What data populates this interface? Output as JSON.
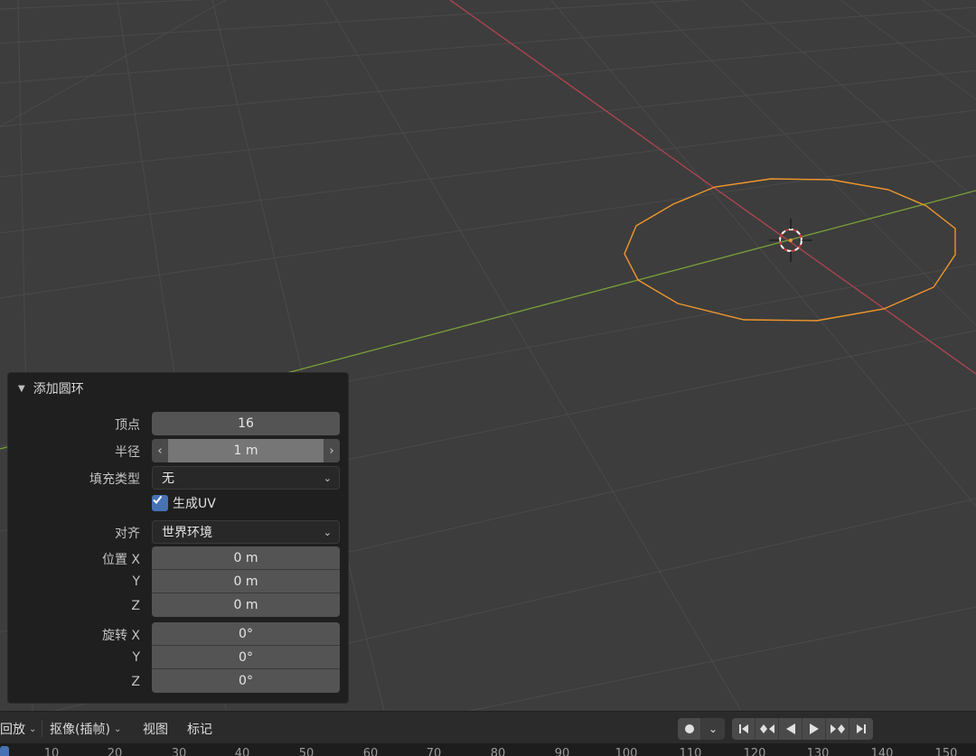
{
  "panel": {
    "title": "添加圆环",
    "labels": {
      "vertices": "顶点",
      "radius": "半径",
      "fill_type": "填充类型",
      "align": "对齐",
      "location": "位置 X",
      "rotation": "旋转 X",
      "y": "Y",
      "z": "Z"
    },
    "vertices": "16",
    "radius": "1 m",
    "fill_type": "无",
    "generate_uv_label": "生成UV",
    "generate_uv_checked": true,
    "align": "世界环境",
    "location": [
      "0 m",
      "0 m",
      "0 m"
    ],
    "rotation": [
      "0°",
      "0°",
      "0°"
    ]
  },
  "timeline": {
    "playback": "回放",
    "keying": "抠像(插帧)",
    "view": "视图",
    "marker": "标记",
    "ruler": [
      "10",
      "20",
      "30",
      "40",
      "50",
      "60",
      "70",
      "80",
      "90",
      "100",
      "110",
      "120",
      "130",
      "140",
      "150"
    ]
  },
  "icons": [
    "chevron-down-icon",
    "checkmark-icon",
    "record-icon",
    "jump-start-icon",
    "prev-keyframe-icon",
    "play-reverse-icon",
    "play-icon",
    "next-keyframe-icon",
    "jump-end-icon",
    "disclosure-triangle-icon",
    "3d-cursor-icon"
  ],
  "colors": {
    "viewport_bg": "#3d3d3d",
    "x_axis": "#b5444f",
    "y_axis": "#7a9e3a",
    "selection": "#f0962c",
    "panel_bg": "#1f1f1f",
    "accent": "#4772b3"
  }
}
